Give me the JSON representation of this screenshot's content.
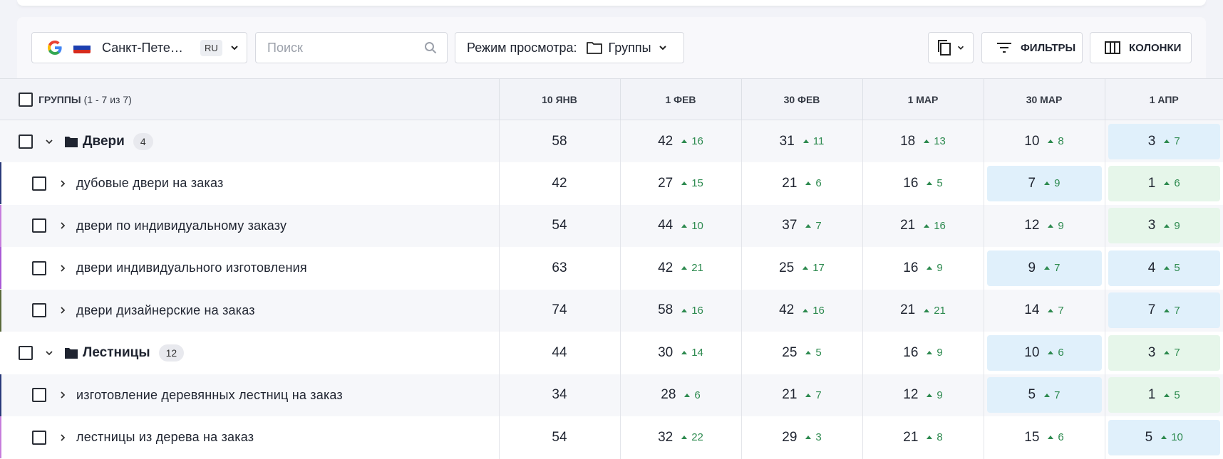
{
  "toolbar": {
    "region": {
      "city": "Санкт-Пете…",
      "lang": "RU",
      "icon": "google-icon",
      "flag": "russia-flag-icon"
    },
    "search": {
      "placeholder": "Поиск",
      "value": ""
    },
    "view_mode": {
      "label": "Режим просмотра:",
      "value": "Группы"
    },
    "filters_label": "ФИЛЬТРЫ",
    "columns_label": "КОЛОНКИ"
  },
  "table": {
    "header": {
      "label": "ГРУППЫ",
      "count": "(1 - 7 из 7)"
    },
    "dates": [
      "10 ЯНВ",
      "1 ФЕВ",
      "30 ФЕВ",
      "1 МАР",
      "30 МАР",
      "1 АПР"
    ],
    "rows": [
      {
        "type": "group",
        "name": "Двери",
        "badge": "4",
        "accent": "",
        "cells": [
          {
            "v": "58",
            "d": "",
            "h": ""
          },
          {
            "v": "42",
            "d": "16",
            "h": ""
          },
          {
            "v": "31",
            "d": "11",
            "h": ""
          },
          {
            "v": "18",
            "d": "13",
            "h": ""
          },
          {
            "v": "10",
            "d": "8",
            "h": ""
          },
          {
            "v": "3",
            "d": "7",
            "h": "blue"
          }
        ]
      },
      {
        "type": "keyword",
        "name": "дубовые двери на заказ",
        "accent": "#2a3a7a",
        "cells": [
          {
            "v": "42",
            "d": "",
            "h": ""
          },
          {
            "v": "27",
            "d": "15",
            "h": ""
          },
          {
            "v": "21",
            "d": "6",
            "h": ""
          },
          {
            "v": "16",
            "d": "5",
            "h": ""
          },
          {
            "v": "7",
            "d": "9",
            "h": "blue"
          },
          {
            "v": "1",
            "d": "6",
            "h": "green"
          }
        ]
      },
      {
        "type": "keyword",
        "name": "двери по индивидуальному заказу",
        "accent": "#c77ddc",
        "cells": [
          {
            "v": "54",
            "d": "",
            "h": ""
          },
          {
            "v": "44",
            "d": "10",
            "h": ""
          },
          {
            "v": "37",
            "d": "7",
            "h": ""
          },
          {
            "v": "21",
            "d": "16",
            "h": ""
          },
          {
            "v": "12",
            "d": "9",
            "h": ""
          },
          {
            "v": "3",
            "d": "9",
            "h": "green"
          }
        ]
      },
      {
        "type": "keyword",
        "name": "двери индивидуального изготовления",
        "accent": "#a95ad6",
        "cells": [
          {
            "v": "63",
            "d": "",
            "h": ""
          },
          {
            "v": "42",
            "d": "21",
            "h": ""
          },
          {
            "v": "25",
            "d": "17",
            "h": ""
          },
          {
            "v": "16",
            "d": "9",
            "h": ""
          },
          {
            "v": "9",
            "d": "7",
            "h": "blue"
          },
          {
            "v": "4",
            "d": "5",
            "h": "blue"
          }
        ]
      },
      {
        "type": "keyword",
        "name": "двери дизайнерские на заказ",
        "accent": "#5a6a3a",
        "cells": [
          {
            "v": "74",
            "d": "",
            "h": ""
          },
          {
            "v": "58",
            "d": "16",
            "h": ""
          },
          {
            "v": "42",
            "d": "16",
            "h": ""
          },
          {
            "v": "21",
            "d": "21",
            "h": ""
          },
          {
            "v": "14",
            "d": "7",
            "h": ""
          },
          {
            "v": "7",
            "d": "7",
            "h": "blue"
          }
        ]
      },
      {
        "type": "group",
        "name": "Лестницы",
        "badge": "12",
        "accent": "",
        "cells": [
          {
            "v": "44",
            "d": "",
            "h": ""
          },
          {
            "v": "30",
            "d": "14",
            "h": ""
          },
          {
            "v": "25",
            "d": "5",
            "h": ""
          },
          {
            "v": "16",
            "d": "9",
            "h": ""
          },
          {
            "v": "10",
            "d": "6",
            "h": "blue"
          },
          {
            "v": "3",
            "d": "7",
            "h": "green"
          }
        ]
      },
      {
        "type": "keyword",
        "name": "изготовление деревянных лестниц на заказ",
        "accent": "#2a3a7a",
        "cells": [
          {
            "v": "34",
            "d": "",
            "h": ""
          },
          {
            "v": "28",
            "d": "6",
            "h": ""
          },
          {
            "v": "21",
            "d": "7",
            "h": ""
          },
          {
            "v": "12",
            "d": "9",
            "h": ""
          },
          {
            "v": "5",
            "d": "7",
            "h": "blue"
          },
          {
            "v": "1",
            "d": "5",
            "h": "green"
          }
        ]
      },
      {
        "type": "keyword",
        "name": "лестницы из дерева на заказ",
        "accent": "#c77ddc",
        "cells": [
          {
            "v": "54",
            "d": "",
            "h": ""
          },
          {
            "v": "32",
            "d": "22",
            "h": ""
          },
          {
            "v": "29",
            "d": "3",
            "h": ""
          },
          {
            "v": "21",
            "d": "8",
            "h": ""
          },
          {
            "v": "15",
            "d": "6",
            "h": ""
          },
          {
            "v": "5",
            "d": "10",
            "h": "blue"
          }
        ]
      }
    ]
  },
  "colors": {
    "delta": "#2d8a4f",
    "highlight_blue": "#e0f0fb",
    "highlight_green": "#e6f6ea"
  }
}
